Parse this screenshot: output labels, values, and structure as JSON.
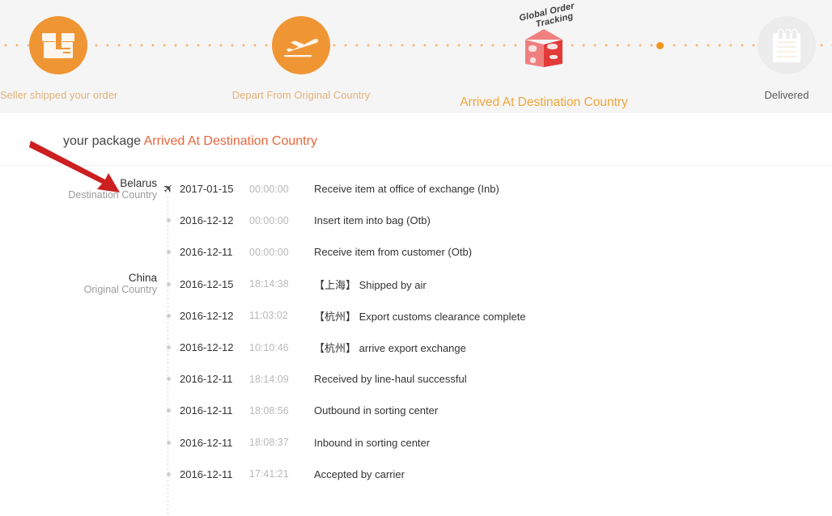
{
  "tracker": {
    "steps": [
      {
        "label": "Seller shipped your order",
        "icon": "package-box-icon",
        "state": "complete"
      },
      {
        "label": "Depart From Original Country",
        "icon": "airplane-takeoff-icon",
        "state": "complete"
      },
      {
        "label": "Arrived At Destination Country",
        "icon": "global-order-tracking-cube-icon",
        "state": "current"
      },
      {
        "label": "Delivered",
        "icon": "notepad-icon",
        "state": "pending"
      }
    ],
    "brand_mark": {
      "line1": "Global Order",
      "line2": "Tracking"
    },
    "colors": {
      "accent_orange": "#f09534",
      "complete_label": "#e3b27c",
      "current_label": "#f0a63a",
      "pending_label": "#5a5a5a",
      "banner_bg": "#f5f5f5",
      "status_red": "#e8653c",
      "annotation_red": "#cc1f1f"
    }
  },
  "heading": {
    "prefix": "your package ",
    "status": "Arrived At Destination Country"
  },
  "timeline": {
    "destination": {
      "name": "Belarus",
      "sub": "Destination Country"
    },
    "origin": {
      "name": "China",
      "sub": "Original Country"
    },
    "events": [
      {
        "country": "destination",
        "marker": "airplane-icon",
        "date": "2017-01-15",
        "time": "00:00:00",
        "place": "",
        "desc": "Receive item at office of exchange (Inb)"
      },
      {
        "country": "",
        "marker": "dot",
        "date": "2016-12-12",
        "time": "00:00:00",
        "place": "",
        "desc": "Insert item into bag (Otb)"
      },
      {
        "country": "",
        "marker": "dot",
        "date": "2016-12-11",
        "time": "00:00:00",
        "place": "",
        "desc": "Receive item from customer (Otb)"
      },
      {
        "country": "origin",
        "marker": "dot",
        "date": "2016-12-15",
        "time": "18:14:38",
        "place": "【上海】",
        "desc": " Shipped by air"
      },
      {
        "country": "",
        "marker": "dot",
        "date": "2016-12-12",
        "time": "11:03:02",
        "place": "【杭州】",
        "desc": " Export customs clearance complete"
      },
      {
        "country": "",
        "marker": "dot",
        "date": "2016-12-12",
        "time": "10:10:46",
        "place": "【杭州】",
        "desc": " arrive export exchange"
      },
      {
        "country": "",
        "marker": "dot",
        "date": "2016-12-11",
        "time": "18:14:09",
        "place": "",
        "desc": "Received by line-haul successful"
      },
      {
        "country": "",
        "marker": "dot",
        "date": "2016-12-11",
        "time": "18:08:56",
        "place": "",
        "desc": "Outbound in sorting center"
      },
      {
        "country": "",
        "marker": "dot",
        "date": "2016-12-11",
        "time": "18:08:37",
        "place": "",
        "desc": "Inbound in sorting center"
      },
      {
        "country": "",
        "marker": "dot",
        "date": "2016-12-11",
        "time": "17:41:21",
        "place": "",
        "desc": "Accepted by carrier"
      }
    ]
  }
}
